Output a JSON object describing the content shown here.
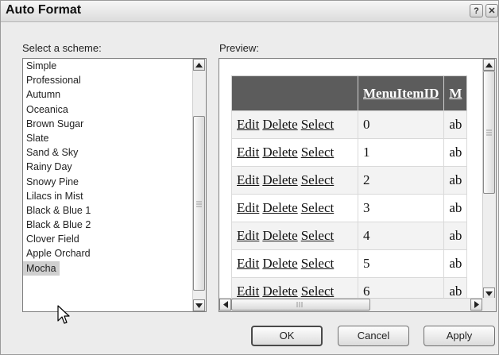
{
  "window": {
    "title": "Auto Format",
    "help_label": "?",
    "close_label": "✕"
  },
  "scheme_list": {
    "label": "Select a scheme:",
    "items": [
      "Simple",
      "Professional",
      "Autumn",
      "Oceanica",
      "Brown Sugar",
      "Slate",
      "Sand & Sky",
      "Rainy Day",
      "Snowy Pine",
      "Lilacs in Mist",
      "Black & Blue 1",
      "Black & Blue 2",
      "Clover Field",
      "Apple Orchard",
      "Mocha"
    ],
    "selected": "Mocha"
  },
  "preview": {
    "label": "Preview:",
    "columns": [
      "",
      "MenuItemID",
      "M"
    ],
    "commands": [
      "Edit",
      "Delete",
      "Select"
    ],
    "rows": [
      {
        "id": "0",
        "trunc": "ab"
      },
      {
        "id": "1",
        "trunc": "ab"
      },
      {
        "id": "2",
        "trunc": "ab"
      },
      {
        "id": "3",
        "trunc": "ab"
      },
      {
        "id": "4",
        "trunc": "ab"
      },
      {
        "id": "5",
        "trunc": "ab"
      },
      {
        "id": "6",
        "trunc": "ab"
      }
    ]
  },
  "buttons": {
    "ok": "OK",
    "cancel": "Cancel",
    "apply": "Apply"
  },
  "icons": [
    "scroll-up-icon",
    "scroll-down-icon",
    "scroll-left-icon",
    "scroll-right-icon",
    "mouse-pointer-icon"
  ]
}
